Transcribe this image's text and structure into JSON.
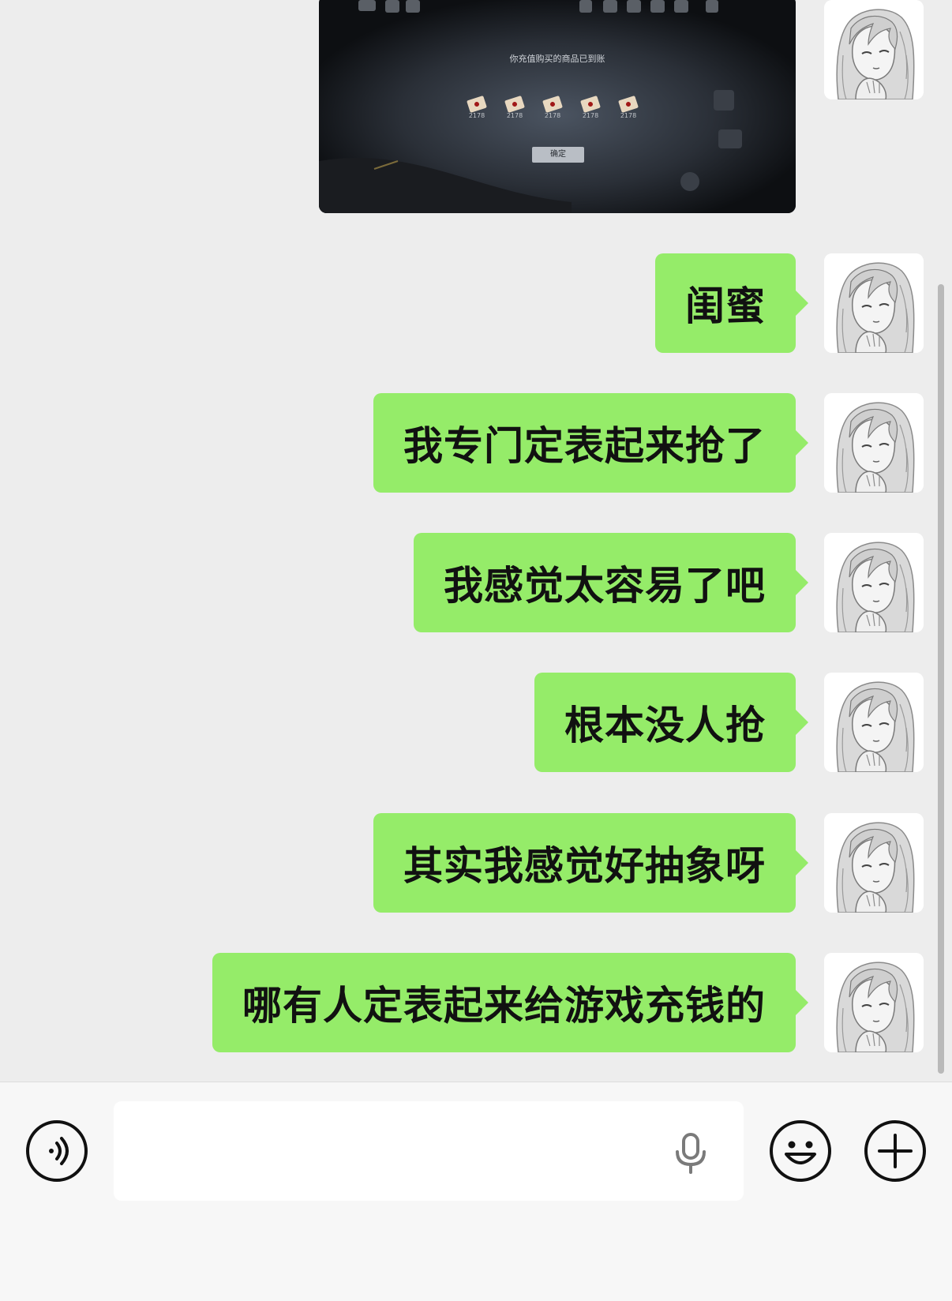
{
  "shared_image": {
    "notice": "你充值购买的商品已到账",
    "items": [
      "2178",
      "2178",
      "2178",
      "2178",
      "2178"
    ],
    "confirm_label": "确定"
  },
  "messages": [
    {
      "text": "闺蜜"
    },
    {
      "text": "我专门定表起来抢了"
    },
    {
      "text": "我感觉太容易了吧"
    },
    {
      "text": "根本没人抢"
    },
    {
      "text": "其实我感觉好抽象呀"
    },
    {
      "text": "哪有人定表起来给游戏充钱的"
    }
  ],
  "input": {
    "value": "",
    "placeholder": ""
  },
  "icons": {
    "voice": "voice-mode-icon",
    "mic": "microphone-icon",
    "emoji": "emoji-icon",
    "plus": "plus-icon"
  },
  "colors": {
    "bubble": "#95ec69",
    "background": "#ededed",
    "input_bar": "#f7f7f7"
  }
}
